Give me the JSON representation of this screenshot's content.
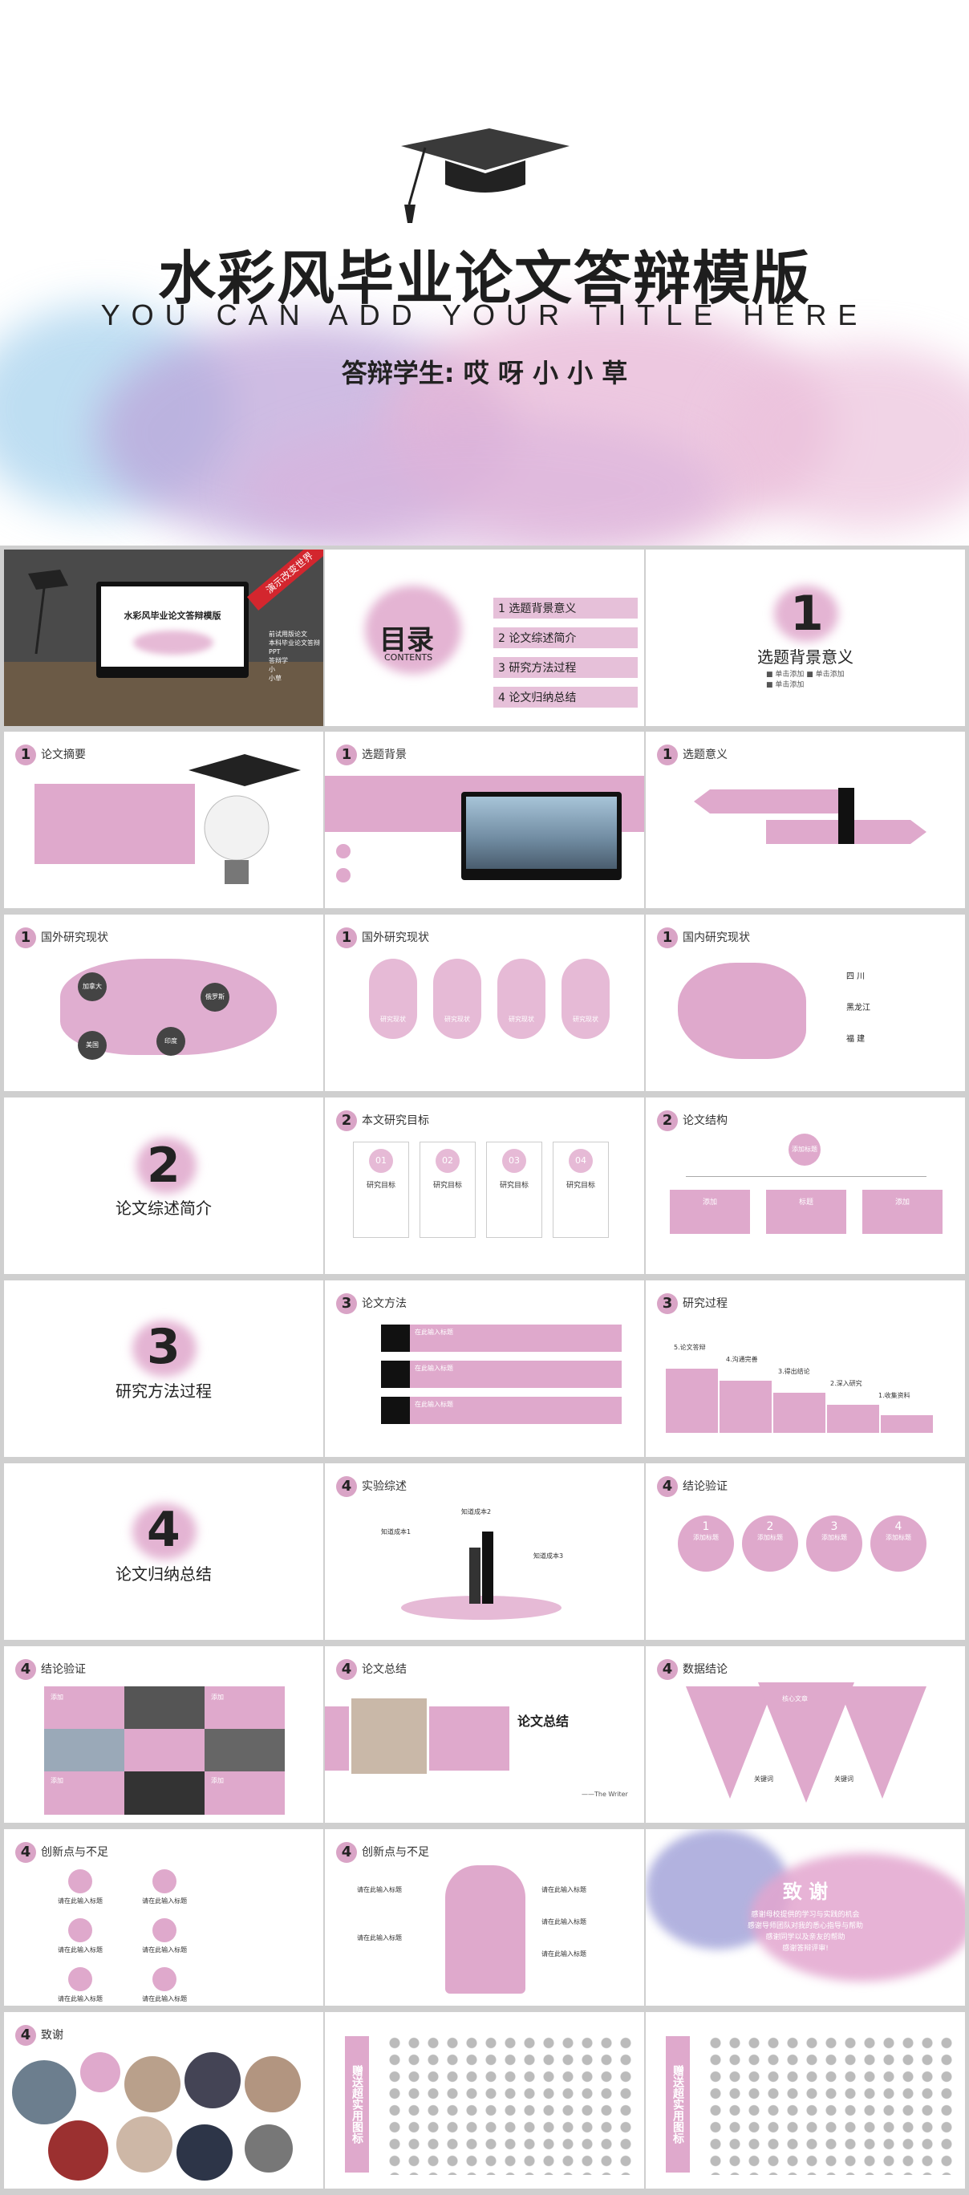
{
  "cover": {
    "title": "水彩风毕业论文答辩模版",
    "subtitle": "YOU CAN ADD YOUR TITLE HERE",
    "student": "答辩学生: 哎 呀 小 小 草"
  },
  "s1": {
    "screen_title": "水彩风毕业论文答辩模版",
    "ribbon": "演示改变世界",
    "note1": "前试用版论文",
    "note2": "本科毕业论文答辩PPT",
    "note3": "答辩学",
    "note4": "小",
    "note5": "小草"
  },
  "toc": {
    "title": "目录",
    "sub": "CONTENTS",
    "items": [
      "1 选题背景意义",
      "2 论文综述简介",
      "3 研究方法过程",
      "4 论文归纳总结"
    ]
  },
  "s3": {
    "num": "1",
    "title": "选题背景意义",
    "b1": "■ 单击添加",
    "b2": "■ 单击添加",
    "b3": "■ 单击添加"
  },
  "abstract": {
    "num": "1",
    "title": "论文摘要"
  },
  "bg": {
    "num": "1",
    "title": "选题背景"
  },
  "meaning": {
    "num": "1",
    "title": "选题意义"
  },
  "foreign1": {
    "num": "1",
    "title": "国外研究现状",
    "labels": [
      "加拿大",
      "俄罗斯",
      "美国",
      "印度"
    ]
  },
  "foreign2": {
    "num": "1",
    "title": "国外研究现状",
    "pill": "研究现状"
  },
  "domestic": {
    "num": "1",
    "title": "国内研究现状",
    "regions": [
      "四  川",
      "黑龙江",
      "福  建"
    ]
  },
  "sec2": {
    "num": "2",
    "title": "论文综述简介"
  },
  "goals": {
    "num": "2",
    "title": "本文研究目标",
    "nums": [
      "01",
      "02",
      "03",
      "04"
    ],
    "head": "研究目标"
  },
  "structure": {
    "num": "2",
    "title": "论文结构",
    "root": "添加标题",
    "children": [
      "添加",
      "标题",
      "添加"
    ]
  },
  "sec3": {
    "num": "3",
    "title": "研究方法过程"
  },
  "method": {
    "num": "3",
    "title": "论文方法",
    "rows": [
      "在此输入标题",
      "在此输入标题",
      "在此输入标题"
    ]
  },
  "process": {
    "num": "3",
    "title": "研究过程",
    "steps": [
      "5.论文答辩",
      "4.沟通完善",
      "3.得出结论",
      "2.深入研究",
      "1.收集资料"
    ]
  },
  "sec4": {
    "num": "4",
    "title": "论文归纳总结"
  },
  "experiment": {
    "num": "4",
    "title": "实验综述",
    "labels": [
      "知道成本1",
      "知道成本2",
      "知道成本3"
    ]
  },
  "verify1": {
    "num": "4",
    "title": "结论验证",
    "circles": [
      "1",
      "2",
      "3",
      "4"
    ],
    "circle_label": "添加标题"
  },
  "verify2": {
    "num": "4",
    "title": "结论验证",
    "labels": [
      "添加",
      "添加",
      "添加",
      "添加"
    ]
  },
  "summary": {
    "num": "4",
    "title": "论文总结",
    "heading": "论文总结",
    "sign": "——The Writer"
  },
  "data": {
    "num": "4",
    "title": "数据结论",
    "tri": "核心文章",
    "key1": "关键词",
    "key2": "关键词"
  },
  "innov1": {
    "num": "4",
    "title": "创新点与不足",
    "item": "请在此输入标题"
  },
  "innov2": {
    "num": "4",
    "title": "创新点与不足",
    "item": "请在此输入标题"
  },
  "thanks": {
    "title": "致 谢",
    "lines": [
      "感谢母校提供的学习与实践的机会",
      "感谢导师团队对我的悉心指导与帮助",
      "感谢同学以及亲友的帮助",
      "感谢答辩评审!"
    ]
  },
  "thanks2": {
    "num": "4",
    "title": "致谢"
  },
  "icons1": {
    "label": "赠送超实用图标"
  },
  "icons2": {
    "label": "赠送超实用图标"
  }
}
